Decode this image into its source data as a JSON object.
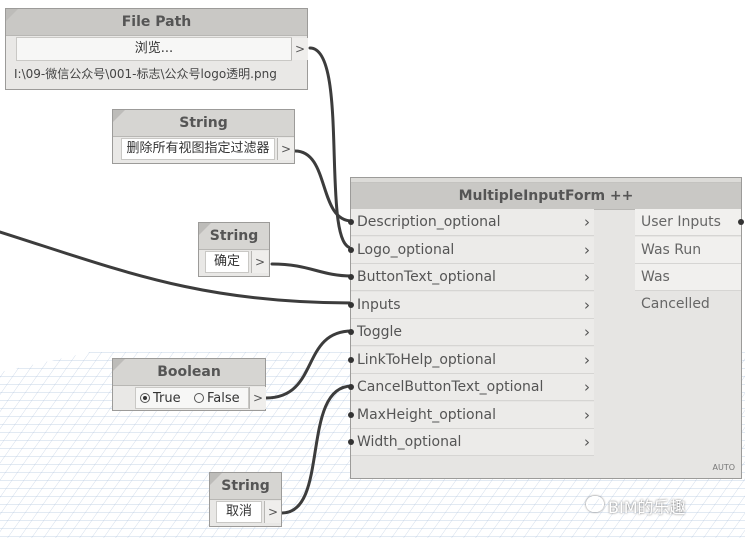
{
  "nodes": {
    "file_path": {
      "title": "File Path",
      "button": "浏览...",
      "value": "I:\\09-微信公众号\\001-标志\\公众号logo透明.png",
      "port": ">"
    },
    "string_top": {
      "title": "String",
      "value": "删除所有视图指定过滤器",
      "port": ">"
    },
    "string_confirm": {
      "title": "String",
      "value": "确定",
      "port": ">"
    },
    "boolean": {
      "title": "Boolean",
      "true_label": "True",
      "false_label": "False",
      "selected": "True",
      "port": ">"
    },
    "string_cancel": {
      "title": "String",
      "value": "取消",
      "port": ">"
    },
    "multiple_input_form": {
      "title": "MultipleInputForm ++",
      "inputs": [
        "Description_optional",
        "Logo_optional",
        "ButtonText_optional",
        "Inputs",
        "Toggle",
        "LinkToHelp_optional",
        "CancelButtonText_optional",
        "MaxHeight_optional",
        "Width_optional"
      ],
      "outputs": [
        "User Inputs",
        "Was Run",
        "Was Cancelled"
      ],
      "lacing": "AUTO"
    }
  },
  "watermark": "BIM的乐趣",
  "colors": {
    "canvas": "#ffffff",
    "node_body": "#e9e8e6",
    "node_header": "#d6d5d2",
    "wire": "#3c3c3c",
    "grid": "#9fb8d6"
  }
}
